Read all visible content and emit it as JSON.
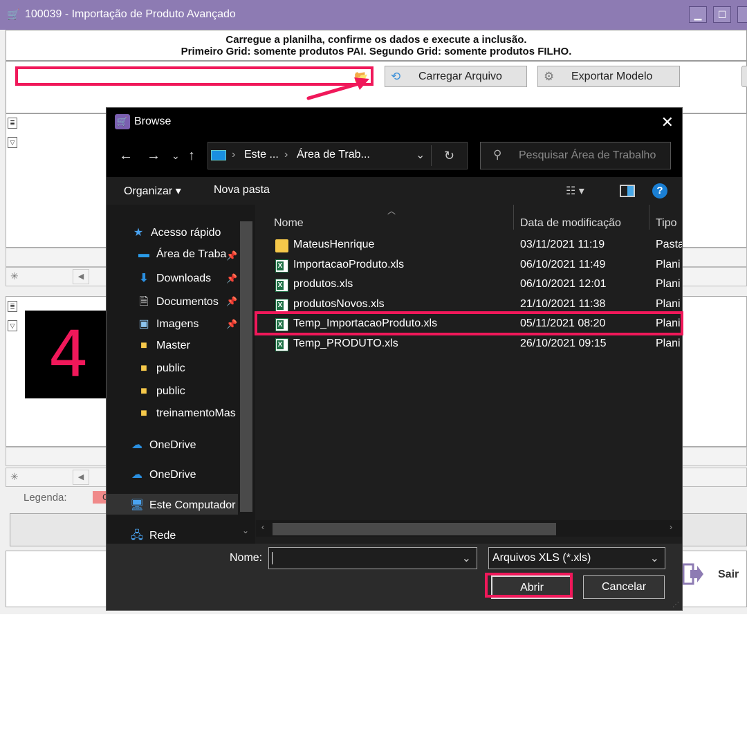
{
  "app": {
    "title": "100039 - Importação de Produto Avançado",
    "instructions_line1": "Carregue a planilha, confirme os dados e execute a inclusão.",
    "instructions_line2": "Primeiro Grid: somente produtos PAI. Segundo Grid: somente produtos FILHO.",
    "load_file_label": "Carregar Arquivo",
    "export_model_label": "Exportar Modelo",
    "legend_label": "Legenda:",
    "legend_item": "Co",
    "exit_label": "Sair",
    "step_number": "4",
    "colors": {
      "titlebar": "#8d7bb3",
      "highlight": "#f0185a"
    }
  },
  "dialog": {
    "title": "Browse",
    "breadcrumb": [
      "Este ...",
      "Área de Trab..."
    ],
    "search_placeholder": "Pesquisar Área de Trabalho",
    "organize_label": "Organizar",
    "new_folder_label": "Nova pasta",
    "nav_items": [
      {
        "label": "Acesso rápido",
        "icon": "star-icon"
      },
      {
        "label": "Área de Traba",
        "icon": "desktop-icon",
        "pinned": true
      },
      {
        "label": "Downloads",
        "icon": "download-icon",
        "pinned": true
      },
      {
        "label": "Documentos",
        "icon": "document-icon",
        "pinned": true
      },
      {
        "label": "Imagens",
        "icon": "image-icon",
        "pinned": true
      },
      {
        "label": "Master",
        "icon": "folder-icon"
      },
      {
        "label": "public",
        "icon": "folder-icon"
      },
      {
        "label": "public",
        "icon": "folder-icon"
      },
      {
        "label": "treinamentoMas",
        "icon": "folder-icon"
      },
      {
        "label": "OneDrive",
        "icon": "cloud-icon"
      },
      {
        "label": "OneDrive",
        "icon": "cloud-icon"
      },
      {
        "label": "Este Computador",
        "icon": "computer-icon"
      },
      {
        "label": "Rede",
        "icon": "network-icon"
      }
    ],
    "columns": [
      "Nome",
      "Data de modificação",
      "Tipo"
    ],
    "files": [
      {
        "name": "MateusHenrique",
        "date": "03/11/2021 11:19",
        "type": "Pasta",
        "kind": "folder"
      },
      {
        "name": "ImportacaoProduto.xls",
        "date": "06/10/2021 11:49",
        "type": "Plani",
        "kind": "xls"
      },
      {
        "name": "produtos.xls",
        "date": "06/10/2021 12:01",
        "type": "Plani",
        "kind": "xls"
      },
      {
        "name": "produtosNovos.xls",
        "date": "21/10/2021 11:38",
        "type": "Plani",
        "kind": "xls"
      },
      {
        "name": "Temp_ImportacaoProduto.xls",
        "date": "05/11/2021 08:20",
        "type": "Plani",
        "kind": "xls"
      },
      {
        "name": "Temp_PRODUTO.xls",
        "date": "26/10/2021 09:15",
        "type": "Plani",
        "kind": "xls"
      }
    ],
    "name_label": "Nome:",
    "name_value": "",
    "filter_value": "Arquivos XLS (*.xls)",
    "open_label": "Abrir",
    "cancel_label": "Cancelar"
  }
}
